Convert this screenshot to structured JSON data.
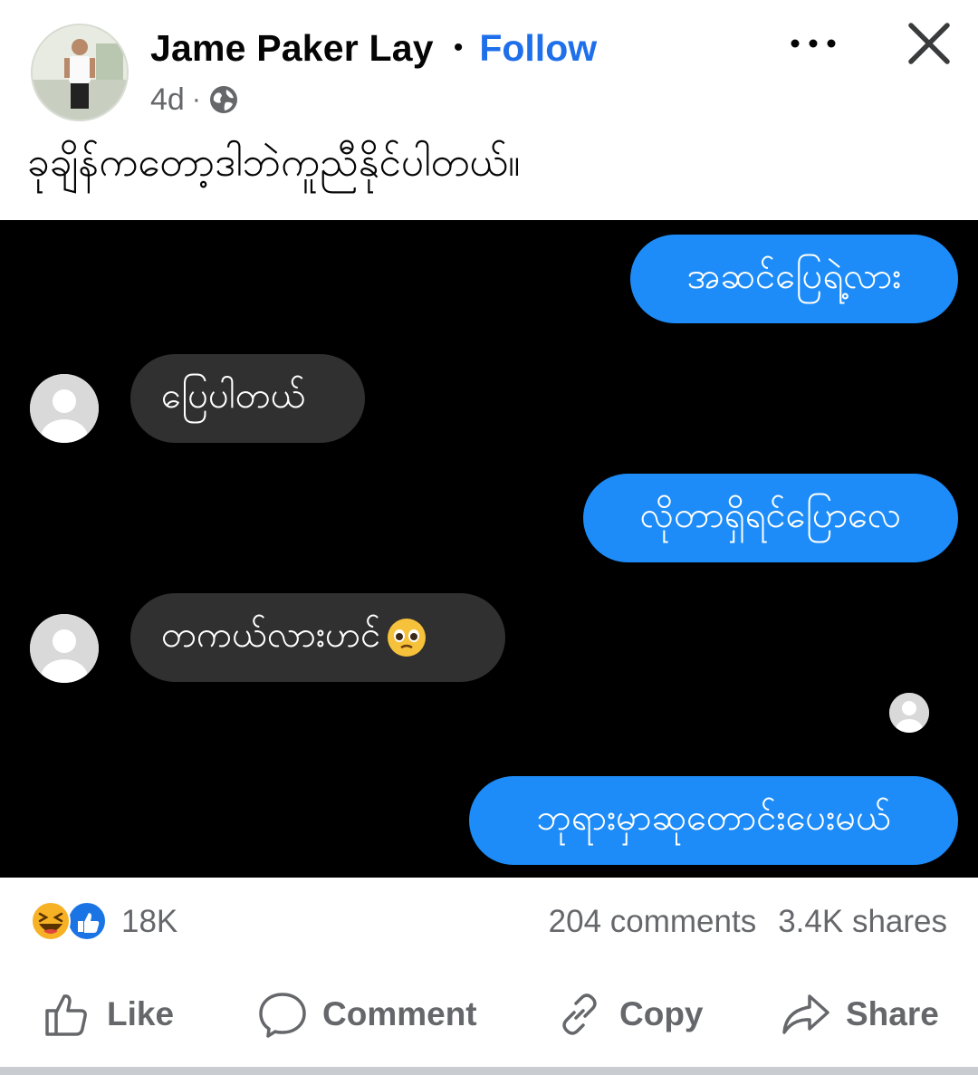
{
  "post": {
    "author": "Jame Paker Lay",
    "separator": "•",
    "follow_label": "Follow",
    "time": "4d",
    "meta_dot": "·",
    "privacy_icon": "globe-icon",
    "caption": "ခုချိန်ကတော့ဒါဘဲကူညီနိုင်ပါတယ်။"
  },
  "chat": {
    "messages": [
      {
        "side": "out",
        "text": "အဆင်ပြေရဲ့လား"
      },
      {
        "side": "in",
        "text": "ပြေပါတယ်"
      },
      {
        "side": "out",
        "text": "လိုတာရှိရင်ပြောလေ"
      },
      {
        "side": "in",
        "text": "တကယ်လားဟင်",
        "emoji": "pleading-face"
      },
      {
        "side": "out",
        "text": "ဘုရားမှာဆုတောင်းပေးမယ်"
      }
    ],
    "colors": {
      "outgoing": "#1d8cf8",
      "incoming": "#303030",
      "background": "#000000"
    }
  },
  "stats": {
    "reactions": [
      "haha-icon",
      "like-icon"
    ],
    "reaction_count": "18K",
    "comments": "204 comments",
    "shares": "3.4K shares"
  },
  "actions": {
    "like": "Like",
    "comment": "Comment",
    "copy": "Copy",
    "share": "Share"
  },
  "colors": {
    "accent": "#1f6feb",
    "muted": "#65676b"
  }
}
